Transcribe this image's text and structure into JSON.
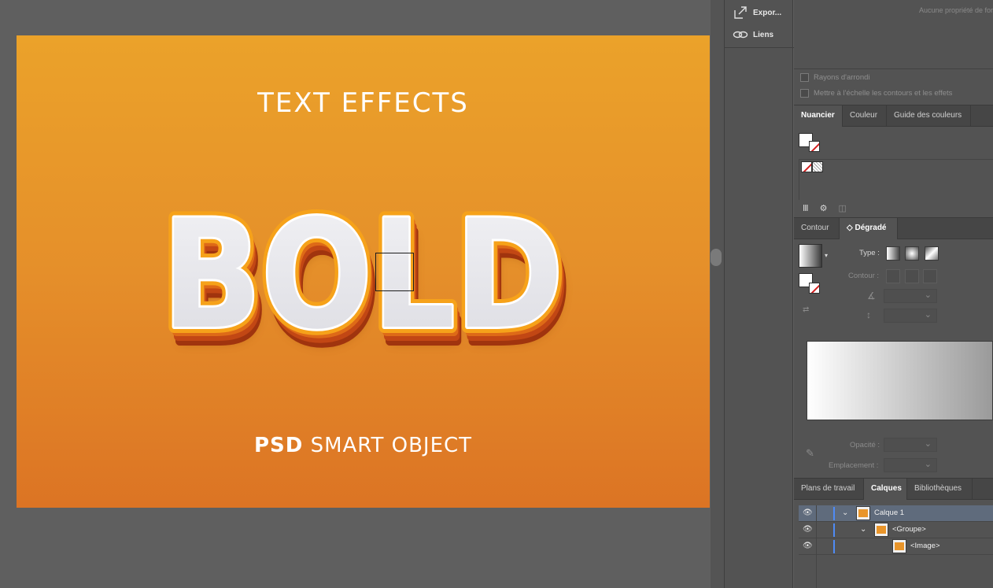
{
  "artboard": {
    "title": "TEXT  EFFECTS",
    "headline": "BOLD",
    "footer_bold": "PSD",
    "footer_rest": " SMART  OBJECT"
  },
  "mid_panel": {
    "items": [
      {
        "icon": "export-icon",
        "label": "Expor..."
      },
      {
        "icon": "links-icon",
        "label": "Liens"
      }
    ]
  },
  "properties": {
    "hint": "Aucune propriété de for",
    "checkboxes": [
      {
        "label": "Rayons d'arrondi",
        "checked": false
      },
      {
        "label": "Mettre à l'échelle les contours et les effets",
        "checked": false
      }
    ]
  },
  "swatches_tabs": [
    "Nuancier",
    "Couleur",
    "Guide des couleurs"
  ],
  "swatches_active": "Nuancier",
  "gradient_tabs": [
    "Contour",
    "◇ Dégradé"
  ],
  "gradient_active": "◇ Dégradé",
  "gradient": {
    "type_label": "Type :",
    "contour_label": "Contour :",
    "opacity_label": "Opacité :",
    "position_label": "Emplacement :",
    "angle_icon": "angle-icon",
    "aspect_icon": "aspect-ratio-icon"
  },
  "layers_tabs": [
    "Plans de travail",
    "Calques",
    "Bibliothèques"
  ],
  "layers_active": "Calques",
  "layers": [
    {
      "name": "Calque 1",
      "level": 0,
      "expanded": true,
      "selected": true
    },
    {
      "name": "<Groupe>",
      "level": 1,
      "expanded": true,
      "selected": false
    },
    {
      "name": "<Image>",
      "level": 2,
      "expanded": false,
      "selected": false
    }
  ],
  "colors": {
    "artboard_top": "#eba22a",
    "artboard_bottom": "#dc7424",
    "selected_layer": "#5f6b7c",
    "layer_color_bar": "#4f8bf5"
  }
}
